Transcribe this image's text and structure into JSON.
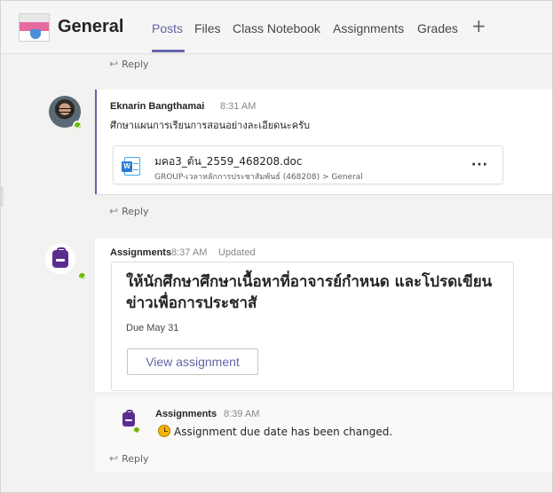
{
  "header": {
    "team_name": "General",
    "tabs": [
      {
        "label": "Posts",
        "active": true
      },
      {
        "label": "Files",
        "active": false
      },
      {
        "label": "Class Notebook",
        "active": false
      },
      {
        "label": "Assignments",
        "active": false
      },
      {
        "label": "Grades",
        "active": false
      }
    ],
    "add_tab_icon": "+",
    "accent_color": "#6264a7"
  },
  "posts": {
    "reply_label": "Reply",
    "reply_icon": "↩",
    "post1": {
      "author": "Eknarin Bangthamai",
      "time": "8:31 AM",
      "message": "ศึกษาแผนการเรียนการสอนอย่างละเอียดนะครับ",
      "file": {
        "name": "มคอ3_ต้น_2559_468208.doc",
        "path": "GROUP-เวลาหลักการประชาสัมพันธ์ (468208) > General",
        "icon": "word-icon",
        "more_label": "···"
      }
    },
    "post2": {
      "author": "Assignments",
      "time": "8:37 AM",
      "status": "Updated",
      "title": "ให้นักศึกษาศึกษาเนื้อหาที่อาจารย์กำหนด และโปรดเขียนข่าวเพื่อการประชาสั",
      "due": "Due May 31",
      "button_label": "View assignment"
    },
    "post3": {
      "author": "Assignments",
      "time": "8:39 AM",
      "message": "Assignment due date has been changed.",
      "icon": "clock-icon"
    }
  }
}
